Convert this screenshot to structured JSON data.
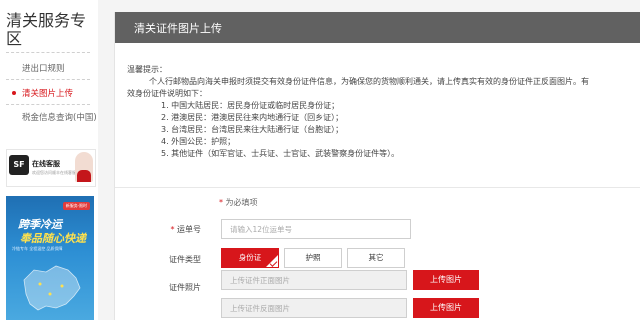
{
  "sidebar": {
    "title": "清关服务专区",
    "items": [
      {
        "label": "进出口规则"
      },
      {
        "label": "清关图片上传"
      },
      {
        "label": "税金信息查询(中国)"
      }
    ]
  },
  "service_card": {
    "logo": "SF",
    "label": "在线客服",
    "sub": "欢迎您访问顺丰在线客服"
  },
  "promo": {
    "tag": "新服务·限时",
    "headline1": "跨季冷运",
    "headline2": "奉品随心快递",
    "sub": "冷链专车 全程温控 品质保障"
  },
  "main": {
    "title": "清关证件图片上传",
    "notice": {
      "heading": "温馨提示：",
      "line1": "个人行邮物品向海关申报时须提交有效身份证件信息，为确保您的货物顺利通关，请上传真实有效的身份证件正反面图片。有",
      "line2": "效身份证件说明如下：",
      "items": [
        "1. 中国大陆居民：居民身份证或临时居民身份证；",
        "2. 港澳居民：港澳居民往来内地通行证（回乡证）；",
        "3. 台湾居民：台湾居民来往大陆通行证（台胞证）；",
        "4. 外国公民：护照；",
        "5. 其他证件（如军官证、士兵证、士官证、武装警察身份证件等）。"
      ]
    }
  },
  "form": {
    "required_hint": "为必填项",
    "waybill": {
      "label": "运单号",
      "placeholder": "请输入12位运单号"
    },
    "id_type": {
      "label": "证件类型",
      "options": [
        "身份证",
        "护照",
        "其它"
      ],
      "selected": "身份证"
    },
    "photo": {
      "label": "证件照片",
      "front_placeholder": "上传证件正面图片",
      "back_placeholder": "上传证件反面图片",
      "upload_label": "上传图片"
    }
  }
}
